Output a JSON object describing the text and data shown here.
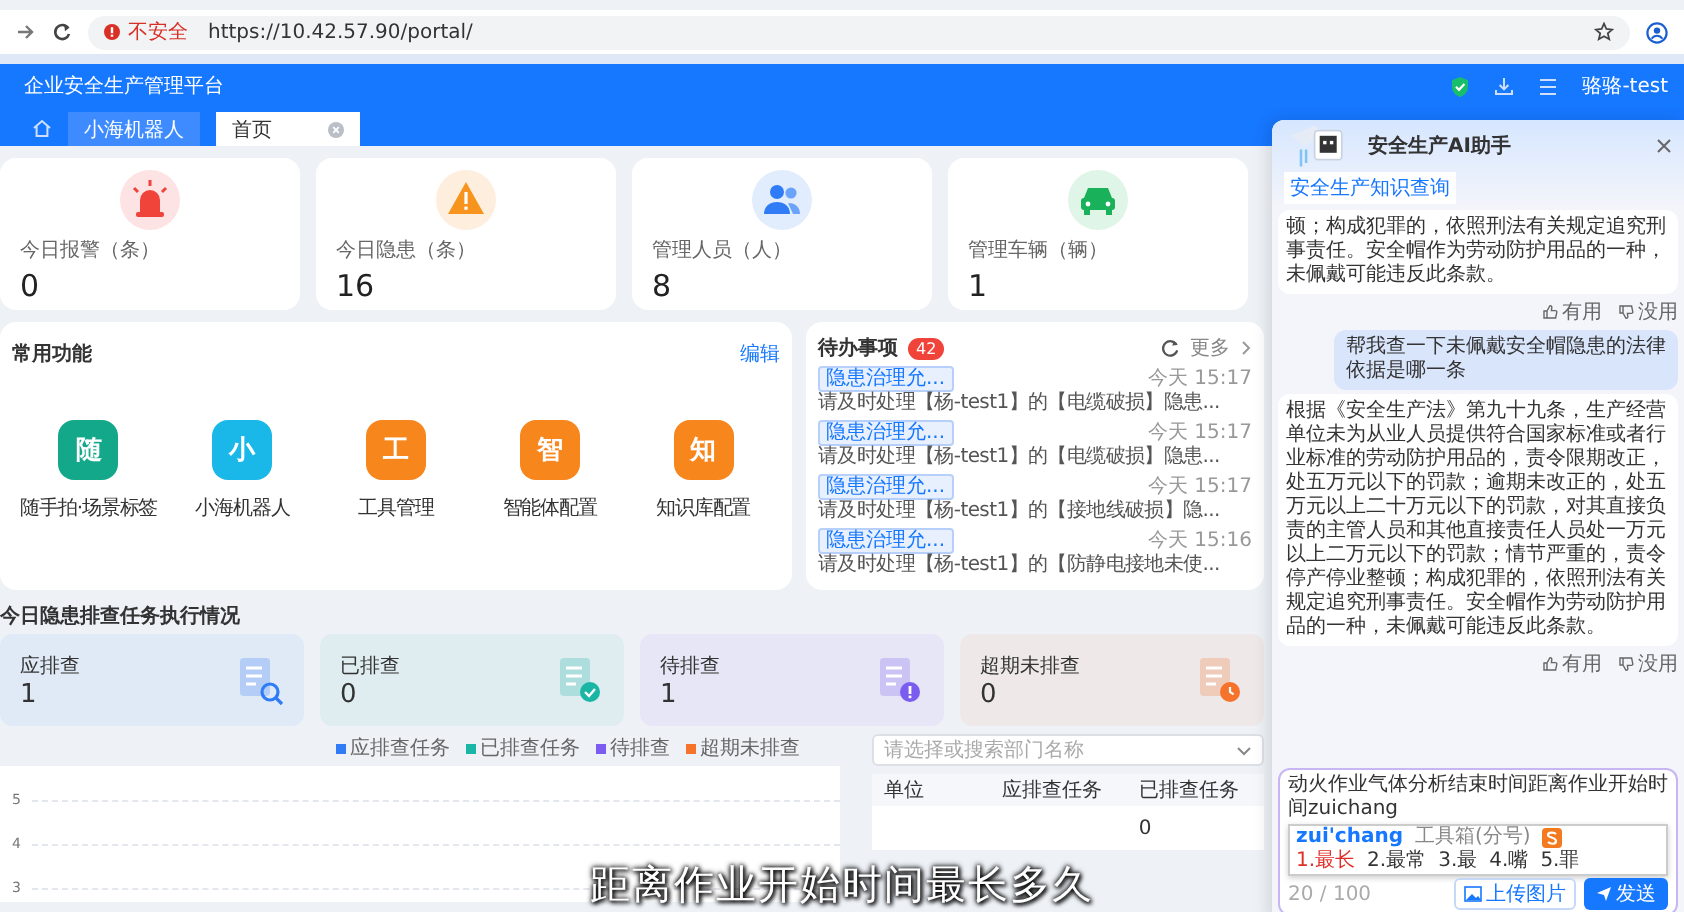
{
  "browser": {
    "security": "不安全",
    "url": "https://10.42.57.90/portal/"
  },
  "header": {
    "title": "企业安全生产管理平台",
    "user": "骆骆-test"
  },
  "tabs": [
    {
      "label": "小海机器人",
      "selected": false,
      "closable": false
    },
    {
      "label": "首页",
      "selected": true,
      "closable": true
    }
  ],
  "stats": [
    {
      "kind": "alarm",
      "label": "今日报警（条）",
      "value": "0"
    },
    {
      "kind": "hazard",
      "label": "今日隐患（条）",
      "value": "16"
    },
    {
      "kind": "people",
      "label": "管理人员（人）",
      "value": "8"
    },
    {
      "kind": "vehicle",
      "label": "管理车辆（辆）",
      "value": "1"
    }
  ],
  "common_functions": {
    "title": "常用功能",
    "edit": "编辑",
    "items": [
      {
        "glyph": "随",
        "label": "随手拍·场景标签",
        "color": "#13a88a"
      },
      {
        "glyph": "小",
        "label": "小海机器人",
        "color": "#1ab8e8"
      },
      {
        "glyph": "工",
        "label": "工具管理",
        "color": "#f7861c"
      },
      {
        "glyph": "智",
        "label": "智能体配置",
        "color": "#f7861c"
      },
      {
        "glyph": "知",
        "label": "知识库配置",
        "color": "#f7861c"
      }
    ]
  },
  "todo": {
    "title": "待办事项",
    "count": "42",
    "more": "更多",
    "items": [
      {
        "tag": "隐患治理允...",
        "text": "请及时处理【杨-test1】的【电缆破损】隐患...",
        "time": "今天 15:17"
      },
      {
        "tag": "隐患治理允...",
        "text": "请及时处理【杨-test1】的【电缆破损】隐患...",
        "time": "今天 15:17"
      },
      {
        "tag": "隐患治理允...",
        "text": "请及时处理【杨-test1】的【接地线破损】隐...",
        "time": "今天 15:17"
      },
      {
        "tag": "隐患治理允...",
        "text": "请及时处理【杨-test1】的【防静电接地未使...",
        "time": "今天 15:16"
      }
    ]
  },
  "task_status": {
    "title": "今日隐患排查任务执行情况",
    "cards": [
      {
        "kind": "search",
        "label": "应排查",
        "value": "1"
      },
      {
        "kind": "check",
        "label": "已排查",
        "value": "0"
      },
      {
        "kind": "alert",
        "label": "待排查",
        "value": "1"
      },
      {
        "kind": "overdue",
        "label": "超期未排查",
        "value": "0"
      }
    ],
    "legend": [
      {
        "label": "应排查任务",
        "color": "#2f7cf6"
      },
      {
        "label": "已排查任务",
        "color": "#19b5a5"
      },
      {
        "label": "待排查",
        "color": "#7a5cf0"
      },
      {
        "label": "超期未排查",
        "color": "#f5732a"
      }
    ],
    "y_ticks": [
      "5",
      "4",
      "3"
    ],
    "department_select": {
      "placeholder": "请选择或搜索部门名称"
    },
    "table": {
      "columns": [
        "单位",
        "应排查任务",
        "已排查任务"
      ],
      "rows": [
        {
          "column_3": "0"
        }
      ]
    }
  },
  "assistant": {
    "title": "安全生产AI助手",
    "quick_link": "安全生产知识查询",
    "messages": [
      {
        "kind": "bot",
        "text": "顿；构成犯罪的，依照刑法有关规定追究刑事责任。安全帽作为劳动防护用品的一种，未佩戴可能违反此条款。",
        "feedback": [
          "有用",
          "没用"
        ]
      },
      {
        "kind": "user",
        "text": "帮我查一下未佩戴安全帽隐患的法律依据是哪一条"
      },
      {
        "kind": "bot",
        "text": "根据《安全生产法》第九十九条，生产经营单位未为从业人员提供符合国家标准或者行业标准的劳动防护用品的，责令限期改正，处五万元以下的罚款；逾期未改正的，处五万元以上二十万元以下的罚款，对其直接负责的主管人员和其他直接责任人员处一万元以上二万元以下的罚款；情节严重的，责令停产停业整顿；构成犯罪的，依照刑法有关规定追究刑事责任。安全帽作为劳动防护用品的一种，未佩戴可能违反此条款。",
        "feedback": [
          "有用",
          "没用"
        ]
      }
    ],
    "input": {
      "value": "动火作业气体分析结束时间距离作业开始时间zuichang",
      "counter": "20 / 100",
      "upload": "上传图片",
      "send": "发送"
    },
    "ime": {
      "pinyin": "zui'chang",
      "toolbox": "工具箱(分号)",
      "candidates": [
        {
          "text": "1.最长",
          "selected": true
        },
        {
          "text": "2.最常",
          "selected": false
        },
        {
          "text": "3.最",
          "selected": false
        },
        {
          "text": "4.嘴",
          "selected": false
        },
        {
          "text": "5.罪",
          "selected": false
        }
      ]
    }
  },
  "subtitle": "距离作业开始时间最长多久"
}
